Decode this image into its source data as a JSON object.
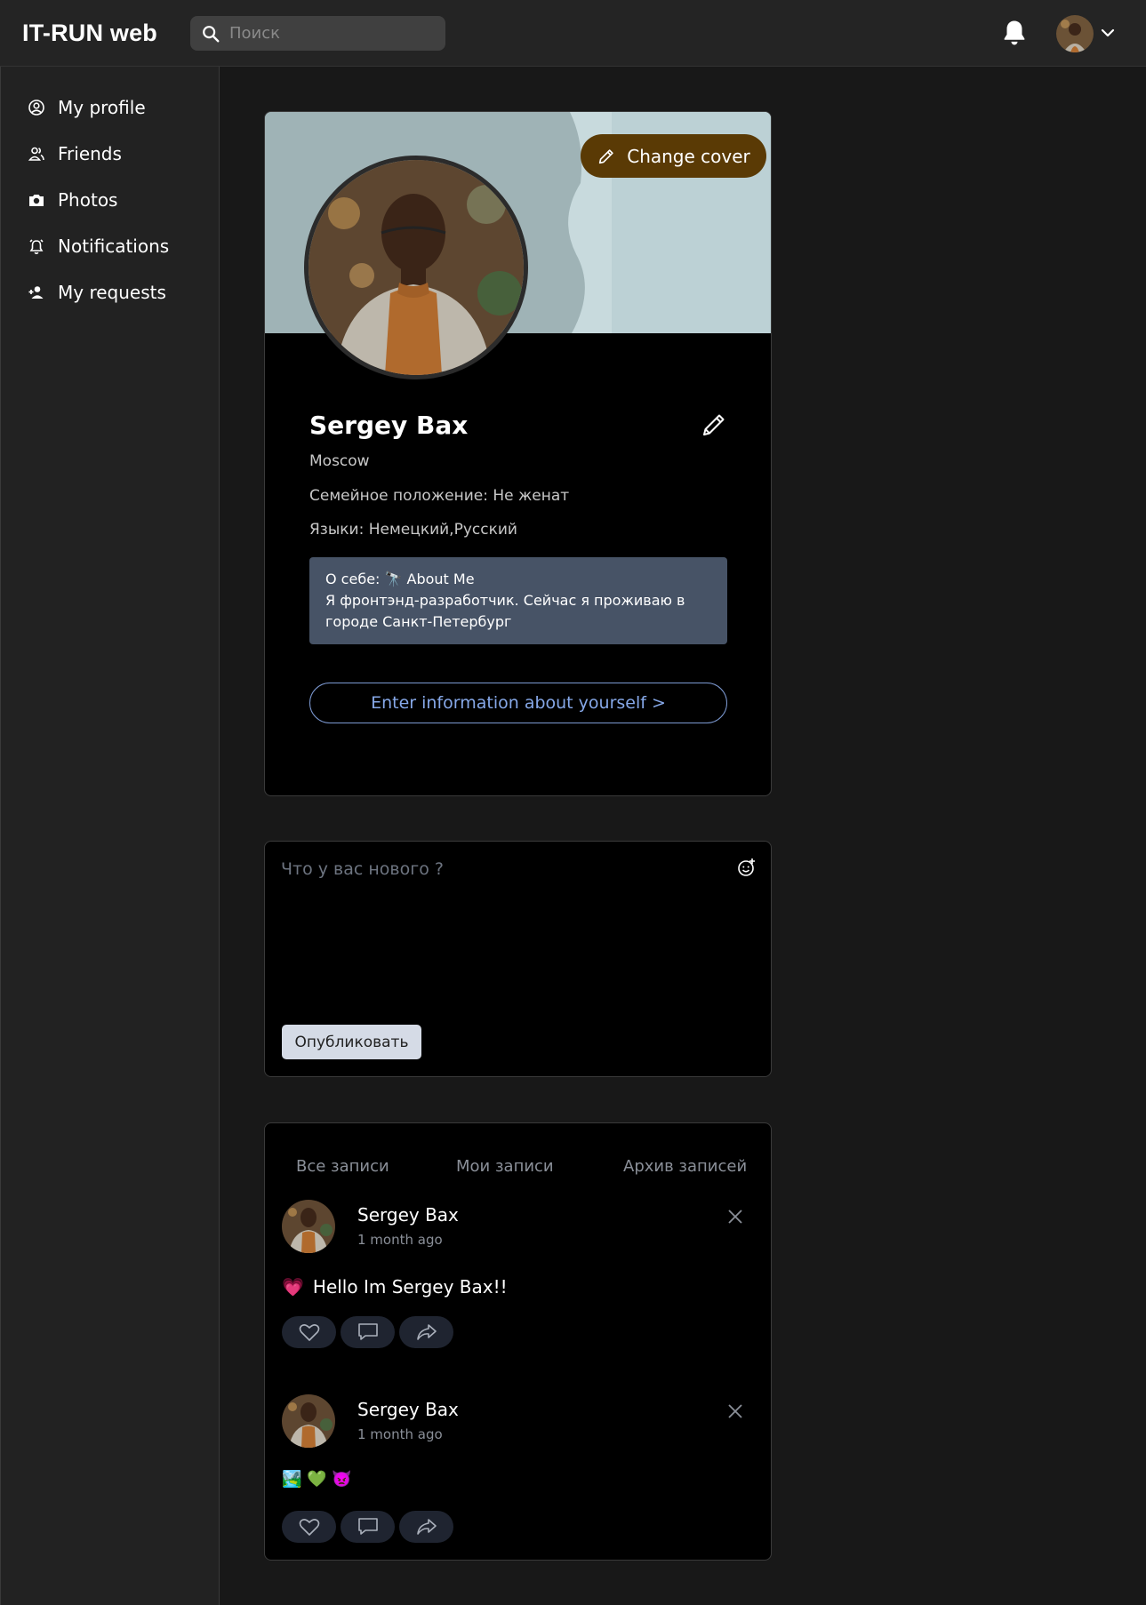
{
  "app": {
    "title": "IT-RUN web",
    "search_placeholder": "Поиск"
  },
  "header_icons": [
    "bell-icon",
    "avatar",
    "chevron-down-icon"
  ],
  "sidebar": {
    "items": [
      {
        "label": "My profile",
        "icon": "user-circle-icon"
      },
      {
        "label": "Friends",
        "icon": "users-icon"
      },
      {
        "label": "Photos",
        "icon": "camera-icon"
      },
      {
        "label": "Notifications",
        "icon": "alarm-icon"
      },
      {
        "label": "My requests",
        "icon": "user-plus-icon"
      }
    ]
  },
  "profile": {
    "change_cover_label": "Change cover",
    "name": "Sergey Bax",
    "city": "Moscow",
    "marital": "Семейное положение: Не женат",
    "languages": "Языки: Немецкий,Русский",
    "about_line1": "О себе: 🔭 About Me",
    "about_line2": "Я фронтэнд-разработчик. Сейчас я проживаю в городе Санкт-Петербург",
    "enter_info_label": "Enter information about yourself >"
  },
  "composer": {
    "placeholder": "Что у вас нового ?",
    "publish_label": "Опубликовать"
  },
  "feed": {
    "tabs": [
      "Все записи",
      "Мои записи",
      "Архив записей"
    ],
    "posts": [
      {
        "author": "Sergey Bax",
        "time": "1 month ago",
        "emoji": "💗",
        "text": "Hello Im Sergey Bax!!"
      },
      {
        "author": "Sergey Bax",
        "time": "1 month ago",
        "emoji": "🏞️ 💚 👿",
        "text": ""
      }
    ]
  },
  "colors": {
    "background": "#181818",
    "header": "#242424",
    "sidebar": "#222222",
    "card": "#000000",
    "cover": "#9fb3b6",
    "change_cover_button": "#5a3a05",
    "about_box": "#475366",
    "accent_link": "#86a8e8"
  }
}
